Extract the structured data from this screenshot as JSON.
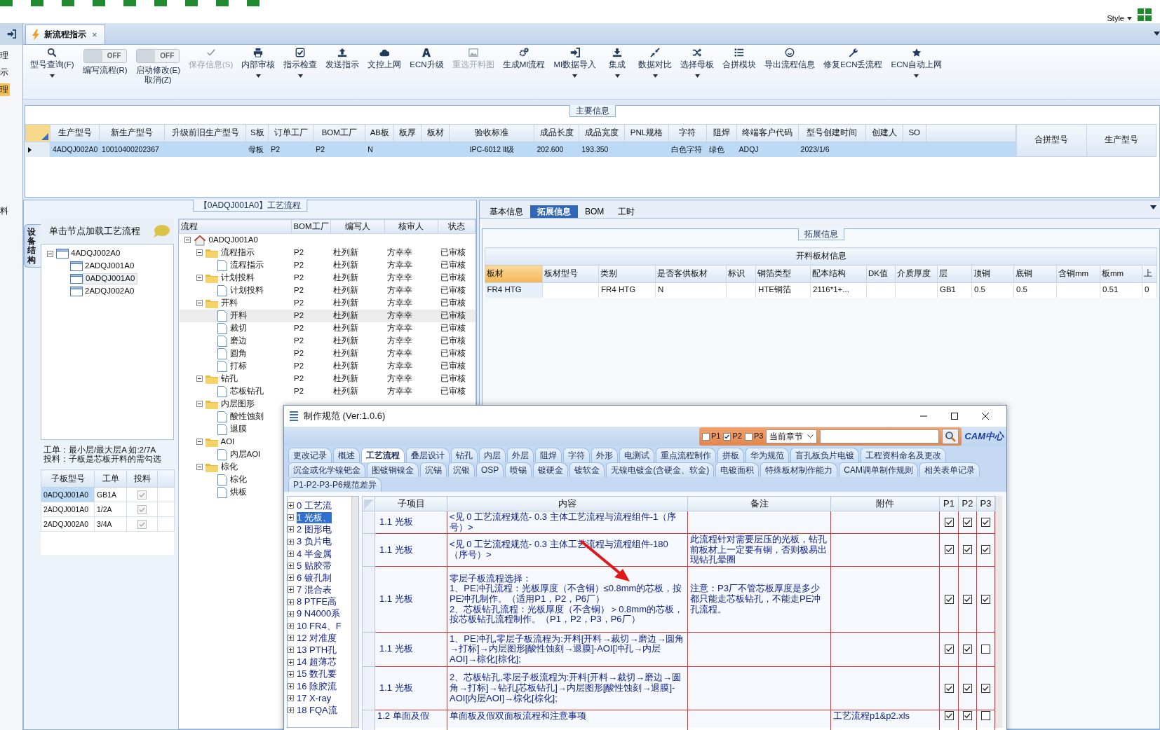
{
  "top_bar": {
    "style_label": "Style"
  },
  "side_strip": [
    {
      "label": "理",
      "selected": false
    },
    {
      "label": "示",
      "selected": false
    },
    {
      "label": "理",
      "selected": true
    },
    {
      "label": "料",
      "selected": false
    }
  ],
  "document_tab": {
    "title": "新流程指示",
    "close": "×"
  },
  "ribbon": {
    "items": [
      {
        "kind": "button",
        "label": "型号查询(F)",
        "dropdown": true,
        "disabled": false
      },
      {
        "kind": "toggle",
        "label": "编写流程(R)",
        "toggle_text": "OFF",
        "on": false
      },
      {
        "kind": "toggle",
        "label": "启动修改(E)",
        "sublabel": "取消(Z)",
        "toggle_text": "OFF",
        "on": false
      },
      {
        "kind": "button",
        "label": "保存信息(S)",
        "dropdown": false,
        "disabled": true
      },
      {
        "kind": "button",
        "label": "内部审核",
        "dropdown": true,
        "disabled": false
      },
      {
        "kind": "button",
        "label": "指示检查",
        "dropdown": true,
        "disabled": false
      },
      {
        "kind": "button",
        "label": "发送指示",
        "dropdown": false,
        "disabled": false
      },
      {
        "kind": "button",
        "label": "文控上网",
        "dropdown": false,
        "disabled": false
      },
      {
        "kind": "button",
        "label": "ECN升级",
        "dropdown": false,
        "disabled": false
      },
      {
        "kind": "button",
        "label": "重选开料图",
        "dropdown": false,
        "disabled": true
      },
      {
        "kind": "button",
        "label": "生成MI流程",
        "dropdown": false,
        "disabled": false
      },
      {
        "kind": "button",
        "label": "MI数据导入",
        "dropdown": true,
        "disabled": false
      },
      {
        "kind": "button",
        "label": "集成",
        "dropdown": true,
        "disabled": false
      },
      {
        "kind": "button",
        "label": "数据对比",
        "dropdown": true,
        "disabled": false
      },
      {
        "kind": "button",
        "label": "选择母板",
        "dropdown": true,
        "disabled": false
      },
      {
        "kind": "button",
        "label": "合拼模块",
        "dropdown": false,
        "disabled": false
      },
      {
        "kind": "button",
        "label": "导出流程信息",
        "dropdown": false,
        "disabled": false
      },
      {
        "kind": "button",
        "label": "修复ECN丢流程",
        "dropdown": false,
        "disabled": false
      },
      {
        "kind": "button",
        "label": "ECN自动上网",
        "dropdown": true,
        "disabled": false
      }
    ]
  },
  "main_info": {
    "title": "主要信息",
    "columns": [
      "生产型号",
      "新生产型号",
      "升级前旧生产型号",
      "S板",
      "订单工厂",
      "BOM工厂",
      "AB板",
      "板厚",
      "板材",
      "验收标准",
      "成品长度",
      "成品宽度",
      "PNL规格",
      "字符",
      "阻焊",
      "终端客户代码",
      "型号创建时间",
      "创建人",
      "SO"
    ],
    "rows": [
      {
        "selected": true,
        "cells": [
          "4ADQJ002A0",
          "10010400202367",
          null,
          "母板",
          "P2",
          "P2",
          "N",
          null,
          null,
          "IPC-6012 Ⅱ级",
          "202.600",
          "193.350",
          null,
          "白色字符",
          "绿色",
          "ADQJ",
          "2023/1/6",
          null,
          null
        ]
      }
    ],
    "side_columns": [
      "合拼型号",
      "生产型号"
    ]
  },
  "process_panel": {
    "title": "【0ADQJ001A0】工艺流程",
    "side_tab": "设备结构",
    "structure_tree": {
      "hint": "单击节点加载工艺流程",
      "nodes": [
        {
          "label": "4ADQJ002A0",
          "expanded": true,
          "selected": false,
          "children": [
            {
              "label": "2ADQJ001A0",
              "selected": false
            },
            {
              "label": "0ADQJ001A0",
              "selected": true
            },
            {
              "label": "2ADQJ002A0",
              "selected": false
            }
          ]
        }
      ]
    },
    "notes": [
      "工单：最小层/最大层A 如:2/7A",
      "投料：子板是芯板开料的需勾选"
    ],
    "sub_boards": {
      "columns": [
        "子板型号",
        "工单",
        "投料"
      ],
      "rows": [
        {
          "model": "0ADQJ001A0",
          "order": "GB1A",
          "feed": true,
          "selected": true
        },
        {
          "model": "2ADQJ001A0",
          "order": "1/2A",
          "feed": true,
          "selected": false
        },
        {
          "model": "2ADQJ002A0",
          "order": "3/4A",
          "feed": true,
          "selected": false
        }
      ]
    },
    "flow_grid": {
      "columns": [
        "流程",
        "BOM工厂",
        "编写人",
        "核审人",
        "状态"
      ],
      "nodes": [
        {
          "kind": "root",
          "label": "0ADQJ001A0",
          "expanded": true,
          "selected": false,
          "children": [
            {
              "kind": "folder",
              "label": "流程指示",
              "expanded": true,
              "selected": false,
              "bom": "P2",
              "writer": "杜列新",
              "reviewer": "方幸幸",
              "status": "已审核",
              "children": [
                {
                  "kind": "doc",
                  "label": "流程指示",
                  "selected": false,
                  "bom": "P2",
                  "writer": "杜列新",
                  "reviewer": "方幸幸",
                  "status": "已审核"
                }
              ]
            },
            {
              "kind": "folder",
              "label": "计划投料",
              "expanded": true,
              "selected": false,
              "bom": "P2",
              "writer": "杜列新",
              "reviewer": "方幸幸",
              "status": "已审核",
              "children": [
                {
                  "kind": "doc",
                  "label": "计划投料",
                  "selected": false,
                  "bom": "P2",
                  "writer": "杜列新",
                  "reviewer": "方幸幸",
                  "status": "已审核"
                }
              ]
            },
            {
              "kind": "folder",
              "label": "开料",
              "expanded": true,
              "selected": false,
              "bom": "P2",
              "writer": "杜列新",
              "reviewer": "方幸幸",
              "status": "已审核",
              "children": [
                {
                  "kind": "doc",
                  "label": "开料",
                  "selected": true,
                  "bom": "P2",
                  "writer": "杜列新",
                  "reviewer": "方幸幸",
                  "status": "已审核"
                },
                {
                  "kind": "doc",
                  "label": "裁切",
                  "selected": false,
                  "bom": "P2",
                  "writer": "杜列新",
                  "reviewer": "方幸幸",
                  "status": "已审核"
                },
                {
                  "kind": "doc",
                  "label": "磨边",
                  "selected": false,
                  "bom": "P2",
                  "writer": "杜列新",
                  "reviewer": "方幸幸",
                  "status": "已审核"
                },
                {
                  "kind": "doc",
                  "label": "圆角",
                  "selected": false,
                  "bom": "P2",
                  "writer": "杜列新",
                  "reviewer": "方幸幸",
                  "status": "已审核"
                },
                {
                  "kind": "doc",
                  "label": "打标",
                  "selected": false,
                  "bom": "P2",
                  "writer": "杜列新",
                  "reviewer": "方幸幸",
                  "status": "已审核"
                }
              ]
            },
            {
              "kind": "folder",
              "label": "钻孔",
              "expanded": true,
              "selected": false,
              "bom": "P2",
              "writer": "杜列新",
              "reviewer": "方幸幸",
              "status": "已审核",
              "children": [
                {
                  "kind": "doc",
                  "label": "芯板钻孔",
                  "selected": false,
                  "bom": "P2",
                  "writer": "杜列新",
                  "reviewer": "方幸幸",
                  "status": "已审核"
                }
              ]
            },
            {
              "kind": "folder",
              "label": "内层图形",
              "expanded": true,
              "selected": false,
              "children": [
                {
                  "kind": "doc",
                  "label": "酸性蚀刻",
                  "selected": false
                },
                {
                  "kind": "doc",
                  "label": "退膜",
                  "selected": false
                }
              ]
            },
            {
              "kind": "folder",
              "label": "AOI",
              "expanded": true,
              "selected": false,
              "children": [
                {
                  "kind": "doc",
                  "label": "内层AOI",
                  "selected": false
                }
              ]
            },
            {
              "kind": "folder",
              "label": "棕化",
              "expanded": true,
              "selected": false,
              "children": [
                {
                  "kind": "doc",
                  "label": "棕化",
                  "selected": false
                },
                {
                  "kind": "doc",
                  "label": "烘板",
                  "selected": false
                }
              ]
            }
          ]
        }
      ]
    }
  },
  "detail_panel": {
    "tabs": [
      {
        "label": "基本信息",
        "selected": false
      },
      {
        "label": "拓展信息",
        "selected": true
      },
      {
        "label": "BOM",
        "selected": false
      },
      {
        "label": "工时",
        "selected": false
      }
    ],
    "group_title": "拓展信息",
    "table_title": "开料板材信息",
    "columns": [
      "板材",
      "板材型号",
      "类别",
      "是否客供板材",
      "标识",
      "铜箔类型",
      "配本结构",
      "DK值",
      "介质厚度",
      "层",
      "顶铜",
      "底铜",
      "含铜mm",
      "板mm",
      "上"
    ],
    "rows": [
      [
        "FR4 HTG",
        null,
        "FR4 HTG",
        "N",
        null,
        "HTE铜箔",
        "2116*1+...",
        null,
        null,
        "GB1",
        "0.5",
        "0.5",
        null,
        "0.51",
        "0"
      ]
    ]
  },
  "spec_dialog": {
    "title": "制作规范 (Ver:1.0.6)",
    "filters": [
      {
        "label": "P1",
        "checked": false
      },
      {
        "label": "P2",
        "checked": true
      },
      {
        "label": "P3",
        "checked": false
      }
    ],
    "scope": "当前章节",
    "logo": "CAM中心",
    "tab_rows": [
      [
        {
          "label": "更改记录",
          "selected": false
        },
        {
          "label": "概述",
          "selected": false
        },
        {
          "label": "工艺流程",
          "selected": true
        },
        {
          "label": "叠层设计",
          "selected": false
        },
        {
          "label": "钻孔",
          "selected": false
        },
        {
          "label": "内层",
          "selected": false
        },
        {
          "label": "外层",
          "selected": false
        },
        {
          "label": "阻焊",
          "selected": false
        },
        {
          "label": "字符",
          "selected": false
        },
        {
          "label": "外形",
          "selected": false
        },
        {
          "label": "电测试",
          "selected": false
        },
        {
          "label": "重点流程制作",
          "selected": false
        },
        {
          "label": "拼板",
          "selected": false
        },
        {
          "label": "华为规范",
          "selected": false
        },
        {
          "label": "盲孔板负片电镀",
          "selected": false
        },
        {
          "label": "工程资料命名及更改",
          "selected": false
        }
      ],
      [
        {
          "label": "沉金或化学镍钯金",
          "selected": false
        },
        {
          "label": "图镀铜镍金",
          "selected": false
        },
        {
          "label": "沉锡",
          "selected": false
        },
        {
          "label": "沉银",
          "selected": false
        },
        {
          "label": "OSP",
          "selected": false
        },
        {
          "label": "喷锡",
          "selected": false
        },
        {
          "label": "镀硬金",
          "selected": false
        },
        {
          "label": "镀软金",
          "selected": false
        },
        {
          "label": "无镍电镀金(含硬金、软金)",
          "selected": false
        },
        {
          "label": "电镀面积",
          "selected": false
        },
        {
          "label": "特殊板材制作能力",
          "selected": false
        },
        {
          "label": "CAM调单制作规则",
          "selected": false
        },
        {
          "label": "相关表单记录",
          "selected": false
        }
      ],
      [
        {
          "label": "P1-P2-P3-P6规范差异",
          "selected": false
        }
      ]
    ],
    "chapters": [
      {
        "label": "0 工艺流",
        "selected": false,
        "expanded": false
      },
      {
        "label": "1 光板、",
        "selected": true,
        "expanded": false
      },
      {
        "label": "2 图形电",
        "selected": false,
        "expanded": false
      },
      {
        "label": "3 负片电",
        "selected": false,
        "expanded": false
      },
      {
        "label": "4 半金属",
        "selected": false,
        "expanded": false
      },
      {
        "label": "5 贴胶带",
        "selected": false,
        "expanded": false
      },
      {
        "label": "6 镀孔制",
        "selected": false,
        "expanded": false
      },
      {
        "label": "7 混合表",
        "selected": false,
        "expanded": false
      },
      {
        "label": "8 PTFE高",
        "selected": false,
        "expanded": false
      },
      {
        "label": "9 N4000系",
        "selected": false,
        "expanded": false
      },
      {
        "label": "10 FR4、F",
        "selected": false,
        "expanded": false
      },
      {
        "label": "12 对准度",
        "selected": false,
        "expanded": false
      },
      {
        "label": "13 PTH孔",
        "selected": false,
        "expanded": false
      },
      {
        "label": "14 超薄芯",
        "selected": false,
        "expanded": false
      },
      {
        "label": "15 数孔要",
        "selected": false,
        "expanded": false
      },
      {
        "label": "16 除胶流",
        "selected": false,
        "expanded": false
      },
      {
        "label": "17 X-ray",
        "selected": false,
        "expanded": false
      },
      {
        "label": "18 FQA流",
        "selected": false,
        "expanded": false
      }
    ],
    "columns": [
      "子项目",
      "内容",
      "备注",
      "附件",
      "P1",
      "P2",
      "P3"
    ],
    "rows": [
      {
        "item": "1.1 光板",
        "content": "<见 0 工艺流程规范- 0.3 主体工艺流程与流程组件-1（序号）>",
        "remark": null,
        "attachment": null,
        "p1": true,
        "p2": true,
        "p3": true
      },
      {
        "item": "1.1 光板",
        "content": "<见 0 工艺流程规范- 0.3 主体工艺流程与流程组件-180（序号）>",
        "remark": "此流程针对需要层压的光板，钻孔前板材上一定要有铜，否则极易出现钻孔晕圈",
        "attachment": null,
        "p1": true,
        "p2": true,
        "p3": true
      },
      {
        "item": "1.1 光板",
        "content": "零层子板流程选择：\n1、PE冲孔流程：光板厚度（不含铜）≤0.8mm的芯板，按PE冲孔制作。（适用P1，P2，P6厂）\n2、芯板钻孔流程：光板厚度（不含铜）＞0.8mm的芯板，按芯板钻孔流程制作。（P1，P2，P3，P6厂）",
        "remark": "注意：P3厂不管芯板厚度是多少都只能走芯板钻孔，不能走PE冲孔流程。",
        "attachment": null,
        "p1": true,
        "p2": true,
        "p3": true
      },
      {
        "item": "1.1 光板",
        "content": "1、PE冲孔,零层子板流程为:开料[开料→裁切→磨边→圆角→打标]→内层图形[酸性蚀刻→退膜]-AOI[冲孔→内层AOI]→棕化[棕化];",
        "remark": null,
        "attachment": null,
        "p1": true,
        "p2": true,
        "p3": false
      },
      {
        "item": "1.1 光板",
        "content": "2、芯板钻孔,零层子板流程为:开料[开料→裁切→磨边→圆角→打标]→钻孔[芯板钻孔]→内层图形[酸性蚀刻→退膜]-AOI[内层AOI]→棕化[棕化];",
        "remark": null,
        "attachment": null,
        "p1": true,
        "p2": true,
        "p3": true
      },
      {
        "item": "1.2 单面及假",
        "content": "单面板及假双面板流程和注意事项",
        "remark": null,
        "attachment": "工艺流程p1&p2.xls",
        "p1": true,
        "p2": true,
        "p3": false
      }
    ]
  }
}
